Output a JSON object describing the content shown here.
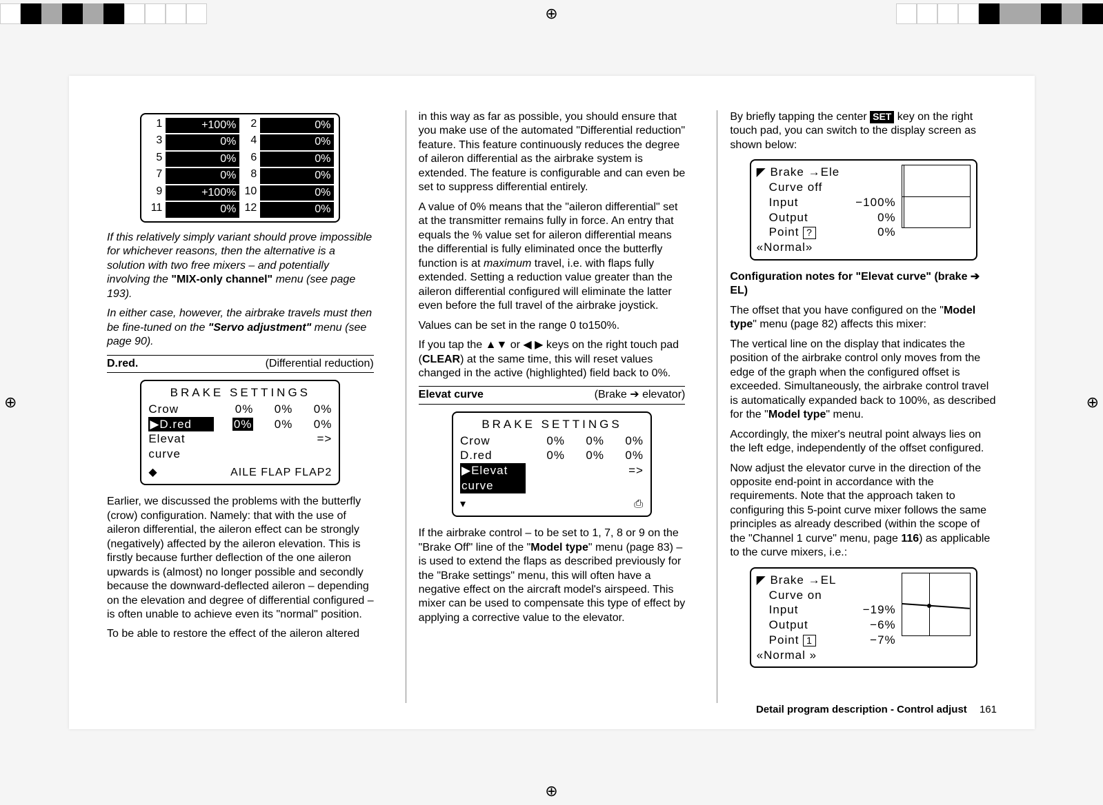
{
  "reg_glyph": "⊕",
  "servo_table": {
    "rows": [
      {
        "n1": "1",
        "v1": "+100%",
        "n2": "2",
        "v2": "0%"
      },
      {
        "n1": "3",
        "v1": "0%",
        "n2": "4",
        "v2": "0%"
      },
      {
        "n1": "5",
        "v1": "0%",
        "n2": "6",
        "v2": "0%"
      },
      {
        "n1": "7",
        "v1": "0%",
        "n2": "8",
        "v2": "0%"
      },
      {
        "n1": "9",
        "v1": "+100%",
        "n2": "10",
        "v2": "0%"
      },
      {
        "n1": "11",
        "v1": "0%",
        "n2": "12",
        "v2": "0%"
      }
    ]
  },
  "col1": {
    "note1": "If this relatively simply variant should prove impossible for whichever reasons, then the alternative is a solution with two free mixers – and potentially involving the ",
    "note1_bold": "\"MIX-only channel\"",
    "note1_tail": " menu (see page 193).",
    "note2_pre": "In either case, however, the airbrake travels must then be fine-tuned on the ",
    "note2_bold": "\"Servo adjustment\"",
    "note2_tail": " menu (see page 90).",
    "subhead_left": "D.red.",
    "subhead_right": "(Differential reduction)",
    "lcd": {
      "title": "BRAKE  SETTINGS",
      "rows": [
        {
          "lab": "Crow",
          "v1": "0%",
          "v2": "0%",
          "v3": "0%",
          "hl": false
        },
        {
          "lab": "▶D.red",
          "v1": "0%",
          "v2": "0%",
          "v3": "0%",
          "hl": true
        },
        {
          "lab": "Elevat curve",
          "v1": "",
          "v2": "",
          "v3": "=>",
          "hl": false
        }
      ],
      "foot_l": "◆",
      "foot_r": "AILE  FLAP FLAP2"
    },
    "p1": "Earlier, we discussed the problems with the butterfly (crow) configuration. Namely: that with the use of aileron differential, the aileron effect can be strongly (negatively) affected by the aileron elevation. This is firstly because further deflection of the one aileron upwards is (almost) no longer possible and secondly because the downward-deflected aileron – depending on the elevation and degree of differential configured – is often unable to achieve even its \"normal\" position.",
    "p2": "To be able to restore the effect of the aileron altered"
  },
  "col2": {
    "p1": "in this way as far as possible, you should ensure that you make use of the automated \"Differential reduction\" feature. This feature continuously reduces the degree of aileron differential as the airbrake system is extended. The feature is configurable and can even be set to suppress differential entirely.",
    "p2_a": "A value of 0% means that the \"aileron differential\" set at the transmitter remains fully in force. An entry that equals the % value set for aileron differential means the differential is fully eliminated once the butterfly function is at ",
    "p2_em": "maximum",
    "p2_b": " travel, i.e. with flaps fully extended. Setting a reduction value greater than the aileron differential configured will eliminate the latter even before the full travel of the airbrake joystick.",
    "p3": "Values can be set in the range 0 to150%.",
    "p4_a": "If you tap the ▲▼ or ◀ ▶ keys on the right touch pad (",
    "p4_bold": "CLEAR",
    "p4_b": ") at the same time, this will reset values changed in the active (highlighted) field back to 0%.",
    "subhead_left": "Elevat curve",
    "subhead_right": "(Brake ➔ elevator)",
    "lcd": {
      "title": "BRAKE  SETTINGS",
      "rows": [
        {
          "lab": "Crow",
          "v1": "0%",
          "v2": "0%",
          "v3": "0%",
          "hl": false
        },
        {
          "lab": "D.red",
          "v1": "0%",
          "v2": "0%",
          "v3": "0%",
          "hl": false
        },
        {
          "lab": "▶Elevat curve",
          "v1": "",
          "v2": "",
          "v3": "=>",
          "hl": true
        }
      ],
      "foot_l": "▾",
      "foot_r": "⎙"
    },
    "p5_a": "If the airbrake control – to be set to 1, 7, 8 or 9 on the \"Brake Off\" line of the \"",
    "p5_bold": "Model type",
    "p5_b": "\" menu (page 83) – is used to extend the flaps as described previously for the \"Brake settings\" menu, this will often have a negative effect on the aircraft model's airspeed. This mixer can be used to compensate this type of effect by applying a corrective value to the elevator."
  },
  "col3": {
    "p1_a": "By briefly tapping the center ",
    "p1_set": "SET",
    "p1_b": " key on the right touch pad, you can switch to the display screen as shown below:",
    "lcd1": {
      "title_line": "◤ Brake  →Ele",
      "l2": "Curve off",
      "l3_l": "Input",
      "l3_r": "−100%",
      "l4_l": "Output",
      "l4_r": "0%",
      "l5_l": "Point",
      "l5_box": "?",
      "l5_r": "0%",
      "l6": "«Normal»"
    },
    "h1": "Configuration notes for \"Elevat curve\" (brake ➔ EL)",
    "p2_a": "The offset that you have configured on the \"",
    "p2_bold1": "Model type",
    "p2_b": "\" menu (page 82) affects this mixer:",
    "p3_a": "The vertical line on the display that indicates the position of the airbrake control only moves from the edge of the graph when the configured offset is exceeded. Simultaneously, the airbrake control travel is automatically expanded back to 100%, as described for the \"",
    "p3_bold": "Model type",
    "p3_b": "\" menu.",
    "p4": "Accordingly, the mixer's neutral point always lies on the left edge, independently of the offset configured.",
    "p5_a": "Now adjust the elevator curve in the direction of the opposite end-point in accordance with the requirements. Note that the approach taken to configuring this 5-point curve mixer follows the same principles as already described (within the scope of the \"Channel 1 curve\" menu, page ",
    "p5_bold": "116",
    "p5_b": ") as applicable to the curve mixers, i.e.:",
    "lcd2": {
      "title_line": "◤ Brake  →EL",
      "l2": "Curve on",
      "l3_l": "Input",
      "l3_r": "−19%",
      "l4_l": "Output",
      "l4_r": "−6%",
      "l5_l": "Point",
      "l5_box": "1",
      "l5_r": "−7%",
      "l6": "«Normal  »"
    }
  },
  "footer": {
    "label": "Detail program description - Control adjust",
    "page": "161"
  }
}
